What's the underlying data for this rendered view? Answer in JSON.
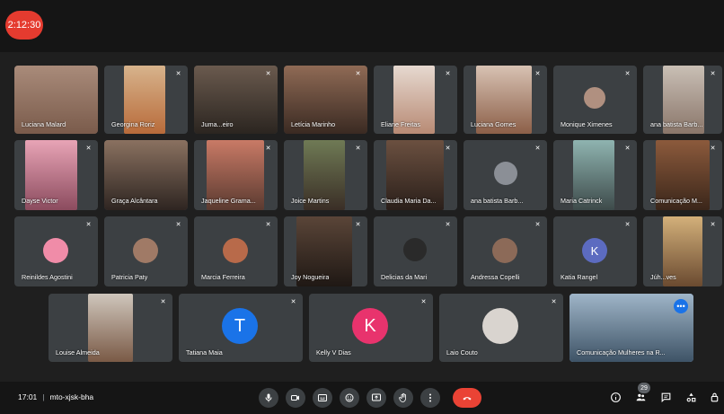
{
  "timer": "2:12:30",
  "meeting": {
    "time": "17:01",
    "code": "mto-xjsk-bha",
    "people_count": "29"
  },
  "participants": {
    "row1": [
      "Luciana Malard",
      "Georgina Roriz",
      "Juma...eiro",
      "Letícia Marinho",
      "Eliane Freitas",
      "Luciana Gomes",
      "Monique Ximenes",
      "ana batista Barb..."
    ],
    "row2": [
      "Dayse Victor",
      "Graça Alcântara",
      "Jaqueline Grama...",
      "Joice Martins",
      "Claudia Maria Da...",
      "ana batista Barb...",
      "Maria Catrinck",
      "Comunicação M..."
    ],
    "row3": [
      "Reinildes Agostini",
      "Patricia Paty",
      "Marcia Ferreira",
      "Joy Nogueira",
      "Delicias da Mari",
      "Andressa Copelli",
      "Katia Rangel",
      "Júh...ves"
    ],
    "row4": [
      "Louise Almeida",
      "Tatiana Maia",
      "Kelly V Dias",
      "Laio Couto",
      "Comunicação Mulheres na R..."
    ]
  },
  "avatars": {
    "katia": "K",
    "tatiana": "T",
    "kelly": "K"
  },
  "colors": {
    "background": "#1f1f1f",
    "tile": "#3c4043",
    "hangup": "#ea4335",
    "timer": "#e53b2f",
    "avatar_blue": "#1a73e8",
    "avatar_pink": "#e8336d",
    "avatar_indigo": "#5c6bc0",
    "highlight": "#8ab4f8"
  },
  "controls": [
    "mic-icon",
    "camera-icon",
    "captions-icon",
    "emoji-icon",
    "present-icon",
    "raise-hand-icon",
    "more-icon",
    "hangup-icon"
  ],
  "right_icons": [
    "info-icon",
    "people-icon",
    "chat-icon",
    "activities-icon",
    "host-controls-icon"
  ]
}
